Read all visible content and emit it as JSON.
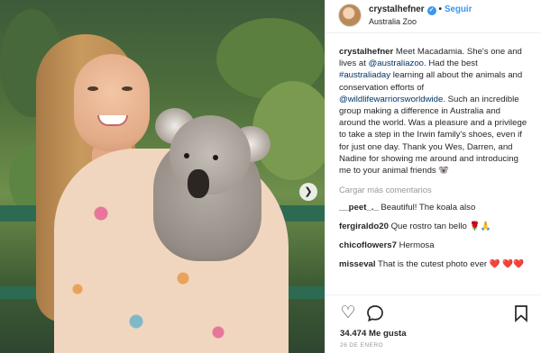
{
  "photo": {
    "alt_subject": "koala-photo"
  },
  "header": {
    "username": "crystalhefner",
    "separator": "•",
    "follow_label": "Seguir",
    "location": "Australia Zoo"
  },
  "caption": {
    "username": "crystalhefner",
    "text1": " Meet Macadamia. She's one and lives at ",
    "mention1": "@australiazoo",
    "text2": ". Had the best ",
    "hashtag": "#australiaday",
    "text3": " learning all about the animals and conservation efforts of ",
    "mention2": "@wildlifewarriorsworldwide",
    "text4": ". Such an incredible group making a difference in Australia and around the world. Was a pleasure and a privilege to take a step in the Irwin family's shoes, even if for just one day. Thank you Wes, Darren, and Nadine for showing me around and introducing me to your animal friends 🐨"
  },
  "load_more_label": "Cargar más comentarios",
  "comments": [
    {
      "user": "__peet_._",
      "text": " Beautiful! The koala also"
    },
    {
      "user": "fergiraldo20",
      "text": " Que rostro tan bello 🌹🙏"
    },
    {
      "user": "chicoflowers7",
      "text": " Hermosa"
    },
    {
      "user": "misseval",
      "text": " That is the cutest photo ever ❤️ ❤️❤️"
    }
  ],
  "stats": {
    "likes": "34.474 Me gusta",
    "date": "26 DE ENERO"
  },
  "colors": {
    "accent": "#3897f0",
    "heart": "#ed4956",
    "muted": "#999999"
  }
}
